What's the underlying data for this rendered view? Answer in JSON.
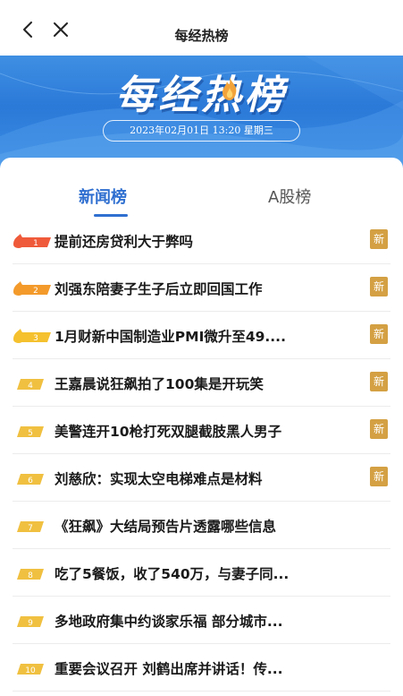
{
  "navbar": {
    "title": "每经热榜",
    "back_icon": "chevron-left-icon",
    "close_icon": "close-icon"
  },
  "banner": {
    "title": "每经热榜",
    "date": "2023年02月01日 13:20 星期三",
    "colors": {
      "bg": "#2b79d8",
      "flame": "#f2a33a"
    }
  },
  "tabs": [
    {
      "label": "新闻榜",
      "active": true
    },
    {
      "label": "A股榜",
      "active": false
    }
  ],
  "colors": {
    "accent": "#2f6fd0",
    "badge": "#d4a043",
    "rank_top": "#ef5a3a",
    "rank_second": "#f39a2b",
    "rank_third": "#f5c12e",
    "rank_other": "#f0c040"
  },
  "news": [
    {
      "rank": "1",
      "title": "提前还房贷利大于弊吗",
      "badge": "新"
    },
    {
      "rank": "2",
      "title": "刘强东陪妻子生子后立即回国工作",
      "badge": "新"
    },
    {
      "rank": "3",
      "title": "1月财新中国制造业PMI微升至49....",
      "badge": "新"
    },
    {
      "rank": "4",
      "title": "王嘉晨说狂飙拍了100集是开玩笑",
      "badge": "新"
    },
    {
      "rank": "5",
      "title": "美警连开10枪打死双腿截肢黑人男子",
      "badge": "新"
    },
    {
      "rank": "6",
      "title": "刘慈欣：实现太空电梯难点是材料",
      "badge": "新"
    },
    {
      "rank": "7",
      "title": "《狂飙》大结局预告片透露哪些信息",
      "badge": ""
    },
    {
      "rank": "8",
      "title": "吃了5餐饭，收了540万，与妻子同...",
      "badge": ""
    },
    {
      "rank": "9",
      "title": "多地政府集中约谈家乐福 部分城市...",
      "badge": ""
    },
    {
      "rank": "10",
      "title": "重要会议召开 刘鹤出席并讲话！传...",
      "badge": ""
    }
  ]
}
